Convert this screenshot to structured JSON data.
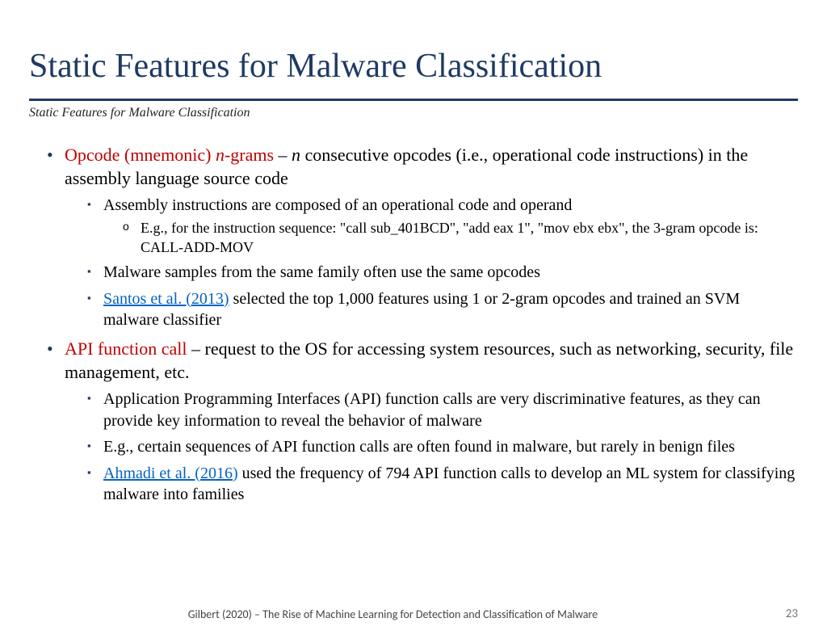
{
  "title": "Static Features for Malware Classification",
  "subtitle": "Static Features for Malware Classification",
  "bullets": {
    "b1": {
      "lead": "Opcode (mnemonic) ",
      "lead_italic": "n",
      "lead_tail": "-grams",
      "dash": " – ",
      "n": "n",
      "rest": " consecutive opcodes (i.e., operational code instructions) in the assembly language source code",
      "sub": [
        "Assembly instructions are composed of an operational code and operand",
        "Malware samples from the same family often use the same opcodes"
      ],
      "subsub": "E.g., for the instruction sequence: \"call sub_401BCD\", \"add eax 1\", \"mov ebx ebx\", the 3-gram opcode is: CALL-ADD-MOV",
      "ref_link": "Santos et al. (2013)",
      "ref_tail": " selected the top 1,000 features using 1 or 2-gram opcodes and trained an SVM malware classifier"
    },
    "b2": {
      "lead": "API function call",
      "dash": " – ",
      "rest": "request to the OS for accessing system resources, such as networking, security, file management, etc.",
      "sub": [
        "Application Programming Interfaces (API) function calls are very discriminative features, as they can provide key information to reveal the behavior of malware",
        "E.g., certain sequences of API function calls are often found in malware, but rarely in benign files"
      ],
      "ref_link": "Ahmadi et al. (2016)",
      "ref_tail": " used the frequency of 794 API function calls to develop an ML system for classifying malware into families"
    }
  },
  "footer": "Gilbert (2020) – The Rise of Machine Learning for Detection and Classification of Malware",
  "page": "23"
}
